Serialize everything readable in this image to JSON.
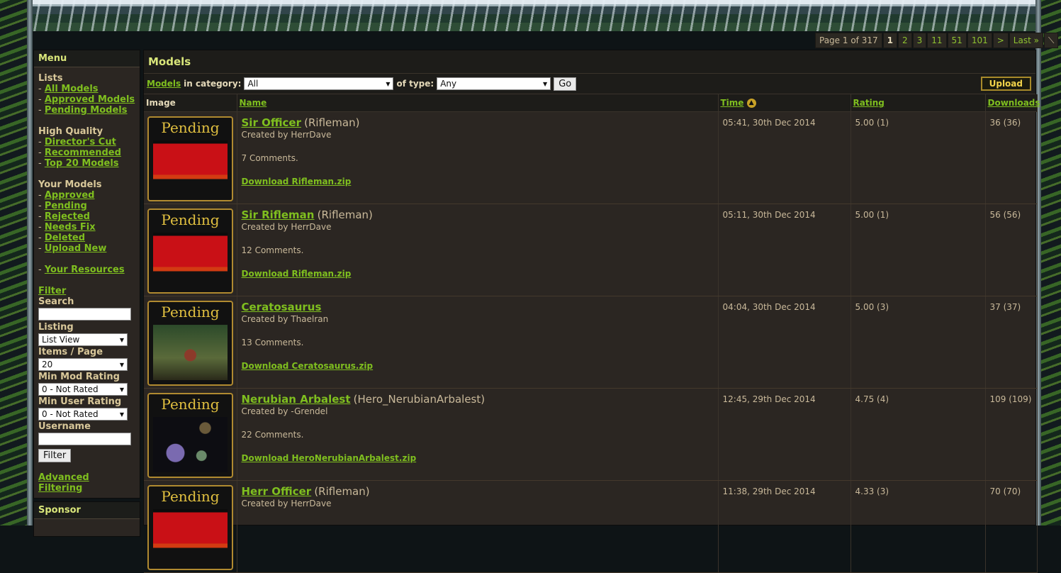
{
  "pagination": {
    "summary": "Page 1 of 317",
    "current": "1",
    "pages": [
      "2",
      "3",
      "11",
      "51",
      "101",
      ">",
      "Last »"
    ],
    "corner": "⟍"
  },
  "sidebar": {
    "menu_title": "Menu",
    "lists_title": "Lists",
    "lists": [
      "All Models",
      "Approved Models",
      "Pending Models"
    ],
    "hq_title": "High Quality",
    "hq": [
      "Director's Cut",
      "Recommended",
      "Top 20 Models"
    ],
    "your_title": "Your Models",
    "your": [
      "Approved",
      "Pending",
      "Rejected",
      "Needs Fix",
      "Deleted",
      "Upload New"
    ],
    "resources": "Your Resources",
    "filter": {
      "title": "Filter",
      "search_label": "Search",
      "listing_label": "Listing",
      "listing_value": "List View",
      "items_label": "Items / Page",
      "items_value": "20",
      "min_mod_label": "Min Mod Rating",
      "min_mod_value": "0 - Not Rated",
      "min_user_label": "Min User Rating",
      "min_user_value": "0 - Not Rated",
      "username_label": "Username",
      "button": "Filter",
      "advanced": "Advanced Filtering"
    },
    "sponsor_title": "Sponsor"
  },
  "main": {
    "title": "Models",
    "toolbar": {
      "models_link": "Models",
      "in_category": "in category:",
      "category_value": "All",
      "of_type": "of type:",
      "type_value": "Any",
      "go": "Go",
      "upload": "Upload"
    },
    "columns": {
      "image": "Image",
      "name": "Name",
      "time": "Time",
      "rating": "Rating",
      "downloads": "Downloads"
    },
    "thumb_label": "Pending",
    "rows": [
      {
        "name": "Sir Officer",
        "type": "(Rifleman)",
        "by": "Created by HerrDave",
        "comments": "7 Comments.",
        "download": "Download Rifleman.zip",
        "time": "05:41, 30th Dec 2014",
        "rating": "5.00 (1)",
        "downloads": "36 (36)",
        "art": "red"
      },
      {
        "name": "Sir Rifleman",
        "type": "(Rifleman)",
        "by": "Created by HerrDave",
        "comments": "12 Comments.",
        "download": "Download Rifleman.zip",
        "time": "05:11, 30th Dec 2014",
        "rating": "5.00 (1)",
        "downloads": "56 (56)",
        "art": "red"
      },
      {
        "name": "Ceratosaurus",
        "type": "",
        "by": "Created by Thaelran",
        "comments": "13 Comments.",
        "download": "Download Ceratosaurus.zip",
        "time": "04:04, 30th Dec 2014",
        "rating": "5.00 (3)",
        "downloads": "37 (37)",
        "art": "forest"
      },
      {
        "name": "Nerubian Arbalest",
        "type": "(Hero_NerubianArbalest)",
        "by": "Created by -Grendel",
        "comments": "22 Comments.",
        "download": "Download HeroNerubianArbalest.zip",
        "time": "12:45, 29th Dec 2014",
        "rating": "4.75 (4)",
        "downloads": "109 (109)",
        "art": "night"
      },
      {
        "name": "Herr Officer",
        "type": "(Rifleman)",
        "by": "Created by HerrDave",
        "comments": "",
        "download": "",
        "time": "11:38, 29th Dec 2014",
        "rating": "4.33 (3)",
        "downloads": "70 (70)",
        "art": "red"
      }
    ]
  }
}
